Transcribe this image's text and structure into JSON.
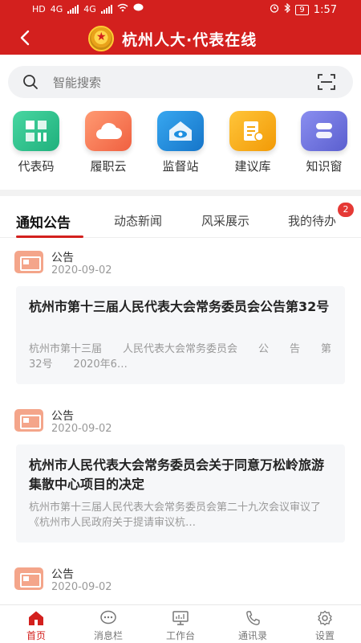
{
  "status_bar": {
    "left_labels": [
      "HD",
      "4G",
      "4G"
    ],
    "time": "1:57",
    "battery": "9"
  },
  "header": {
    "title": "杭州人大·代表在线",
    "back_icon": "back-arrow-icon",
    "logo_icon": "national-emblem-icon",
    "brand_color": "#d3201e"
  },
  "search": {
    "placeholder": "智能搜索",
    "icon": "search-icon",
    "scan_icon": "scan-icon"
  },
  "shortcuts": [
    {
      "label": "代表码",
      "icon": "qr-grid-icon",
      "color": "#2ec48d"
    },
    {
      "label": "履职云",
      "icon": "cloud-icon",
      "color": "#f4795b"
    },
    {
      "label": "监督站",
      "icon": "house-eye-icon",
      "color": "#1d8fe0"
    },
    {
      "label": "建议库",
      "icon": "document-pen-icon",
      "color": "#f6a70f"
    },
    {
      "label": "知识窗",
      "icon": "book-icon",
      "color": "#6a6fd8"
    }
  ],
  "tabs": {
    "items": [
      "通知公告",
      "动态新闻",
      "风采展示",
      "我的待办"
    ],
    "active": "通知公告",
    "badge": "2"
  },
  "notices": [
    {
      "type": "公告",
      "date": "2020-09-02",
      "title": "杭州市第十三届人民代表大会常务委员会公告第32号",
      "body": "杭州市第十三届　　人民代表大会常务委员会　　公　　告　　第32号　　2020年6…"
    },
    {
      "type": "公告",
      "date": "2020-09-02",
      "title": "杭州市人民代表大会常务委员会关于同意万松岭旅游集散中心项目的决定",
      "body": "杭州市第十三届人民代表大会常务委员会第二十九次会议审议了《杭州市人民政府关于提请审议杭…"
    },
    {
      "type": "公告",
      "date": "2020-09-02"
    }
  ],
  "tabbar": [
    {
      "label": "首页",
      "icon": "home-icon",
      "active": true
    },
    {
      "label": "消息栏",
      "icon": "chat-icon",
      "active": false
    },
    {
      "label": "工作台",
      "icon": "monitor-icon",
      "active": false
    },
    {
      "label": "通讯录",
      "icon": "phone-icon",
      "active": false
    },
    {
      "label": "设置",
      "icon": "gear-icon",
      "active": false
    }
  ]
}
